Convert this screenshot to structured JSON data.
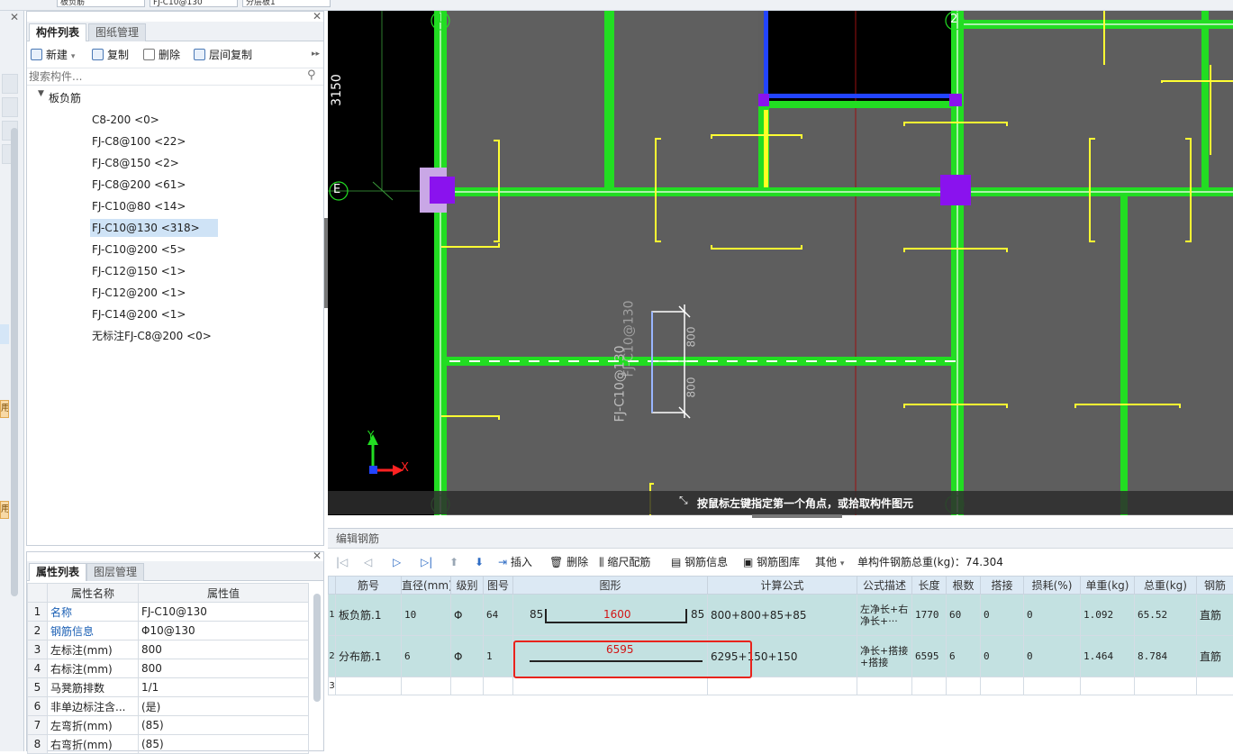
{
  "top": {
    "combo1": "板负筋",
    "combo2": "FJ-C10@130",
    "combo3": "分层板1"
  },
  "component_panel": {
    "tabs": [
      "构件列表",
      "图纸管理"
    ],
    "toolbar": {
      "new": "新建",
      "copy": "复制",
      "delete": "删除",
      "floor_copy": "层间复制"
    },
    "search_placeholder": "搜索构件...",
    "tree_root": "板负筋",
    "items": [
      "C8-200 <0>",
      "FJ-C8@100 <22>",
      "FJ-C8@150 <2>",
      "FJ-C8@200 <61>",
      "FJ-C10@80 <14>",
      "FJ-C10@130 <318>",
      "FJ-C10@200 <5>",
      "FJ-C12@150 <1>",
      "FJ-C12@200 <1>",
      "FJ-C14@200 <1>",
      "无标注FJ-C8@200 <0>"
    ],
    "selected_index": 5
  },
  "property_panel": {
    "tabs": [
      "属性列表",
      "图层管理"
    ],
    "headers": [
      "属性名称",
      "属性值"
    ],
    "rows": [
      {
        "n": "1",
        "name": "名称",
        "value": "FJ-C10@130"
      },
      {
        "n": "2",
        "name": "钢筋信息",
        "value": "Φ10@130"
      },
      {
        "n": "3",
        "name": "左标注(mm)",
        "value": "800"
      },
      {
        "n": "4",
        "name": "右标注(mm)",
        "value": "800"
      },
      {
        "n": "5",
        "name": "马凳筋排数",
        "value": "1/1"
      },
      {
        "n": "6",
        "name": "非单边标注含...",
        "value": "(是)"
      },
      {
        "n": "7",
        "name": "左弯折(mm)",
        "value": "(85)"
      },
      {
        "n": "8",
        "name": "右弯折(mm)",
        "value": "(85)"
      }
    ]
  },
  "canvas": {
    "grid_labels": {
      "col1": "1",
      "col2": "2",
      "rowE": "E"
    },
    "dimension": "3150",
    "rebar_label": "FJ-C10@130",
    "dim_upper": "800",
    "dim_lower": "800",
    "axis_x": "X",
    "axis_y": "Y",
    "status": "按鼠标左键指定第一个角点，或拾取构件图元"
  },
  "rebar_editor": {
    "title": "编辑钢筋",
    "tools": {
      "insert": "插入",
      "delete": "删除",
      "scale": "缩尺配筋",
      "info": "钢筋信息",
      "library": "钢筋图库",
      "other": "其他"
    },
    "total_weight": "单构件钢筋总重(kg)：74.304",
    "headers": [
      "筋号",
      "直径(mm)",
      "级别",
      "图号",
      "图形",
      "计算公式",
      "公式描述",
      "长度",
      "根数",
      "搭接",
      "损耗(%)",
      "单重(kg)",
      "总重(kg)",
      "钢筋"
    ],
    "rows": [
      {
        "n": "1",
        "name": "板负筋.1",
        "dia": "10",
        "grade": "Φ",
        "fig": "64",
        "shape_left": "85",
        "shape_mid": "1600",
        "shape_right": "85",
        "formula": "800+800+85+85",
        "desc": "左净长+右净长+···",
        "len": "1770",
        "count": "60",
        "lap": "0",
        "loss": "0",
        "unit": "1.092",
        "total": "65.52",
        "type": "直筋"
      },
      {
        "n": "2",
        "name": "分布筋.1",
        "dia": "6",
        "grade": "Φ",
        "fig": "1",
        "shape_left": "",
        "shape_mid": "6595",
        "shape_right": "",
        "formula": "6295+150+150",
        "desc": "净长+搭接+搭接",
        "len": "6595",
        "count": "6",
        "lap": "0",
        "loss": "0",
        "unit": "1.464",
        "total": "8.784",
        "type": "直筋"
      },
      {
        "n": "3"
      }
    ]
  }
}
